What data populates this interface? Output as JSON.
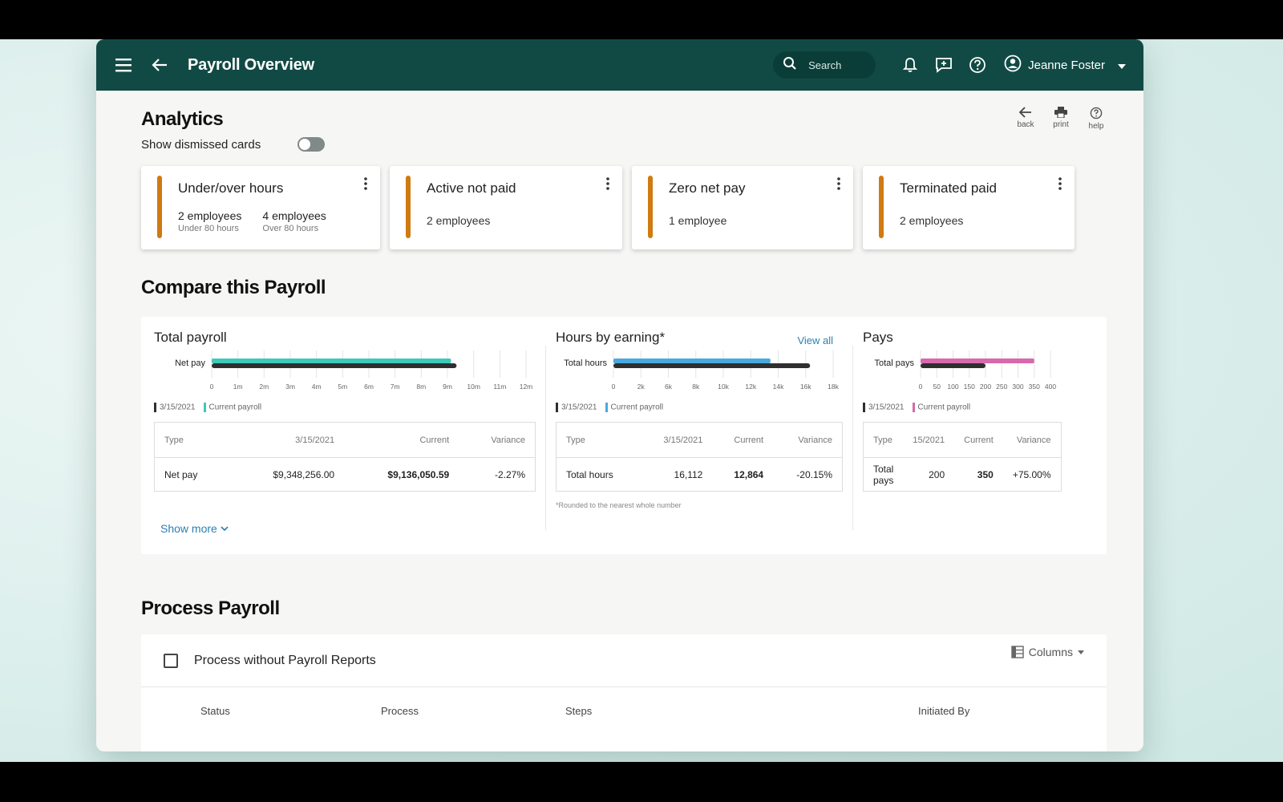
{
  "appbar": {
    "title": "Payroll Overview",
    "search_placeholder": "Search",
    "user_name": "Jeanne Foster"
  },
  "analytics": {
    "heading": "Analytics",
    "toggle_label": "Show dismissed cards",
    "tools": [
      {
        "label": "back",
        "icon": "arrow-left-icon"
      },
      {
        "label": "print",
        "icon": "printer-icon"
      },
      {
        "label": "help",
        "icon": "help-circle-icon"
      }
    ],
    "cards": [
      {
        "title": "Under/over hours",
        "split": [
          {
            "count": "2 employees",
            "hint": "Under 80 hours"
          },
          {
            "count": "4 employees",
            "hint": "Over 80 hours"
          }
        ]
      },
      {
        "title": "Active not paid",
        "count": "2 employees"
      },
      {
        "title": "Zero net pay",
        "count": "1 employee"
      },
      {
        "title": "Terminated paid",
        "count": "2 employees"
      }
    ]
  },
  "compare": {
    "heading": "Compare this Payroll",
    "show_more": "Show more",
    "footnote": "*Rounded to the nearest whole number",
    "legend": {
      "prev": "3/15/2021",
      "curr": "Current payroll"
    },
    "table_headers": {
      "type": "Type",
      "prev": "3/15/2021",
      "prev_short": "15/2021",
      "current": "Current",
      "variance": "Variance"
    },
    "panels": [
      {
        "title": "Total payroll",
        "row": {
          "type": "Net pay",
          "prev": "$9,348,256.00",
          "current": "$9,136,050.59",
          "variance": "-2.27%"
        }
      },
      {
        "title": "Hours by earning*",
        "view_all": "View all",
        "row": {
          "type": "Total hours",
          "prev": "16,112",
          "current": "12,864",
          "variance": "-20.15%"
        }
      },
      {
        "title": "Pays",
        "row": {
          "type": "Total pays",
          "prev": "200",
          "current": "350",
          "variance": "+75.00%"
        }
      }
    ]
  },
  "chart_data": [
    {
      "type": "bar",
      "categories": [
        "Net pay"
      ],
      "series": [
        {
          "name": "3/15/2021",
          "values": [
            9348256
          ],
          "color": "#2f2f2f"
        },
        {
          "name": "Current payroll",
          "values": [
            9136050.59
          ],
          "color": "#3ec9b9"
        }
      ],
      "xlim": [
        0,
        12000000
      ],
      "ticks": [
        "0",
        "1m",
        "2m",
        "3m",
        "4m",
        "5m",
        "6m",
        "7m",
        "8m",
        "9m",
        "10m",
        "11m",
        "12m"
      ],
      "legend": "bottom-left"
    },
    {
      "type": "bar",
      "categories": [
        "Total hours"
      ],
      "series": [
        {
          "name": "3/15/2021",
          "values": [
            16112
          ],
          "color": "#2f2f2f"
        },
        {
          "name": "Current payroll",
          "values": [
            12864
          ],
          "color": "#4aa8e0"
        }
      ],
      "xlim": [
        0,
        18000
      ],
      "ticks": [
        "0",
        "2k",
        "6k",
        "8k",
        "10k",
        "12k",
        "14k",
        "16k",
        "18k"
      ],
      "legend": "bottom-left"
    },
    {
      "type": "bar",
      "categories": [
        "Total pays"
      ],
      "series": [
        {
          "name": "3/15/2021",
          "values": [
            200
          ],
          "color": "#2f2f2f"
        },
        {
          "name": "Current payroll",
          "values": [
            350
          ],
          "color": "#d66aac"
        }
      ],
      "xlim": [
        0,
        400
      ],
      "ticks": [
        "0",
        "50",
        "100",
        "150",
        "200",
        "250",
        "300",
        "350",
        "400"
      ],
      "legend": "bottom-left"
    }
  ],
  "process": {
    "heading": "Process Payroll",
    "checkbox_label": "Process without Payroll Reports",
    "columns_label": "Columns",
    "col_headers": [
      "Status",
      "Process",
      "Steps",
      "Initiated By"
    ]
  },
  "colors": {
    "appbar": "#114a44",
    "accent_bar": "#d07a12",
    "link": "#2a7fb4"
  }
}
